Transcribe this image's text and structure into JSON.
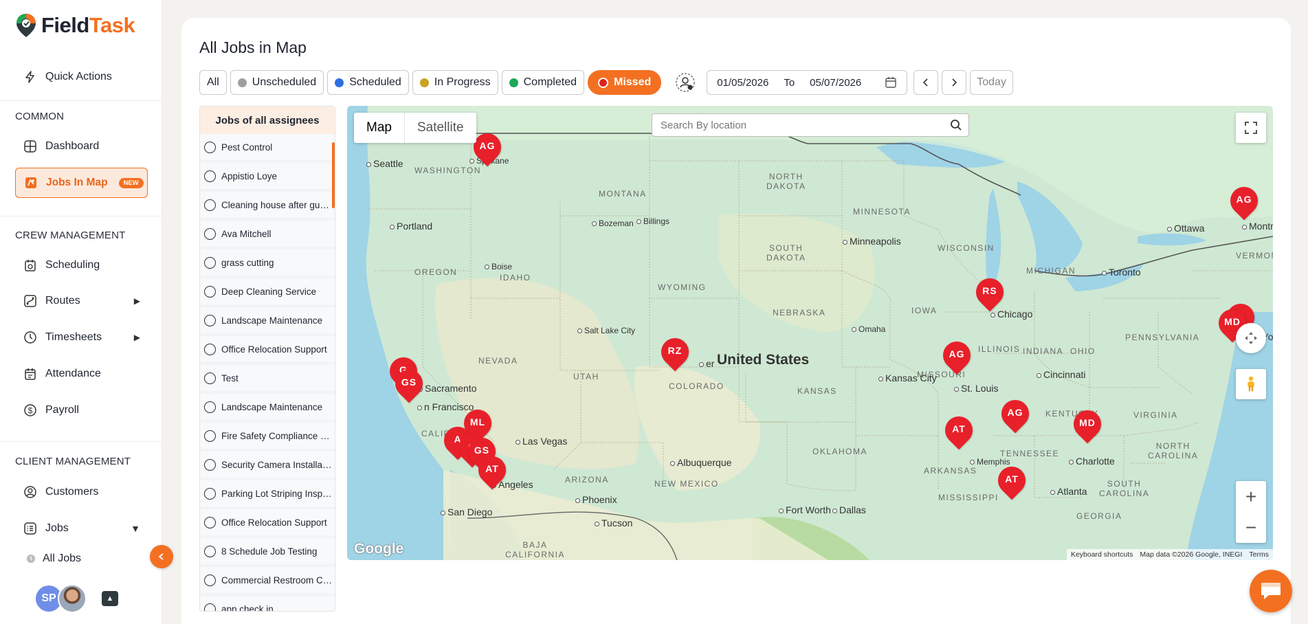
{
  "app": {
    "brand_main": "Field",
    "brand_accent": "Task"
  },
  "sidebar": {
    "quick_actions": "Quick Actions",
    "sections": {
      "common": "COMMON",
      "crew": "CREW MANAGEMENT",
      "client": "CLIENT MANAGEMENT"
    },
    "items": {
      "dashboard": "Dashboard",
      "jobs_in_map": "Jobs In Map",
      "new_badge": "NEW",
      "scheduling": "Scheduling",
      "routes": "Routes",
      "timesheets": "Timesheets",
      "attendance": "Attendance",
      "payroll": "Payroll",
      "customers": "Customers",
      "jobs": "Jobs",
      "all_jobs": "All Jobs"
    },
    "user_initials": "SP"
  },
  "page": {
    "title": "All Jobs in Map"
  },
  "filters": {
    "all": "All",
    "unscheduled": "Unscheduled",
    "scheduled": "Scheduled",
    "in_progress": "In Progress",
    "completed": "Completed",
    "missed": "Missed",
    "colors": {
      "unscheduled": "#9e9e9e",
      "scheduled": "#2f6fe0",
      "in_progress": "#c9a41e",
      "completed": "#1fa85a",
      "missed": "#e02020",
      "accent": "#f37021"
    }
  },
  "date_range": {
    "from": "01/05/2026",
    "to_label": "To",
    "to": "05/07/2026",
    "today": "Today"
  },
  "job_list": {
    "header": "Jobs of all assignees",
    "jobs": [
      "Pest Control",
      "Appistio Loye",
      "Cleaning house after guests",
      "Ava Mitchell",
      "grass cutting",
      "Deep Cleaning Service",
      "Landscape Maintenance",
      "Office Relocation Support",
      "Test",
      "Landscape Maintenance",
      "Fire Safety Compliance Check",
      "Security Camera Installation",
      "Parking Lot Striping Inspection",
      "Office Relocation Support",
      "8 Schedule Job Testing",
      "Commercial Restroom Cleaning",
      "app check in"
    ]
  },
  "map": {
    "type_map": "Map",
    "type_satellite": "Satellite",
    "search_placeholder": "Search By location",
    "google": "Google",
    "attribution": {
      "shortcuts": "Keyboard shortcuts",
      "data": "Map data ©2026 Google, INEGI",
      "terms": "Terms"
    },
    "country": "United States",
    "states": {
      "washington": "WASHINGTON",
      "oregon": "OREGON",
      "idaho": "IDAHO",
      "montana": "MONTANA",
      "wyoming": "WYOMING",
      "nevada": "NEVADA",
      "utah": "UTAH",
      "colorado": "COLORADO",
      "california": "CALIFORNIA",
      "arizona": "ARIZONA",
      "new_mexico": "NEW MEXICO",
      "north_dakota": "NORTH\nDAKOTA",
      "south_dakota": "SOUTH\nDAKOTA",
      "nebraska": "NEBRASKA",
      "kansas": "KANSAS",
      "oklahoma": "OKLAHOMA",
      "minnesota": "MINNESOTA",
      "iowa": "IOWA",
      "missouri": "MISSOURI",
      "arkansas": "ARKANSAS",
      "mississippi": "MISSISSIPPI",
      "wisconsin": "WISCONSIN",
      "michigan": "MICHIGAN",
      "illinois": "ILLINOIS",
      "indiana": "INDIANA",
      "ohio": "OHIO",
      "kentucky": "KENTUCKY",
      "tennessee": "TENNESSEE",
      "georgia": "GEORGIA",
      "pennsylvania": "PENNSYLVANIA",
      "virginia": "VIRGINIA",
      "north_carolina": "NORTH\nCAROLINA",
      "south_carolina": "SOUTH\nCAROLINA",
      "vermont": "VERMONT",
      "baja": "BAJA\nCALIFORNIA"
    },
    "cities": {
      "seattle": "Seattle",
      "spokane": "Spokane",
      "portland": "Portland",
      "boise": "Boise",
      "bozeman": "Bozeman",
      "billings": "Billings",
      "salt_lake": "Salt Lake City",
      "sacramento": "Sacramento",
      "san_francisco": "n Francisco",
      "las_vegas": "Las Vegas",
      "los_angeles": "Angeles",
      "san_diego": "San Diego",
      "phoenix": "Phoenix",
      "tucson": "Tucson",
      "albuquerque": "Albuquerque",
      "denver": "er",
      "omaha": "Omaha",
      "minneapolis": "Minneapolis",
      "kansas_city": "Kansas City",
      "st_louis": "St. Louis",
      "chicago": "Chicago",
      "memphis": "Memphis",
      "fort_worth": "Fort Worth",
      "dallas": "Dallas",
      "atlanta": "Atlanta",
      "charlotte": "Charlotte",
      "cincinnati": "Cincinnati",
      "toronto": "Toronto",
      "ottawa": "Ottawa",
      "montreal": "Montr",
      "new_york": "New Yo"
    },
    "pins": [
      "AG",
      "AG",
      "RS",
      "MD",
      "S",
      "RZ",
      "AG",
      "G",
      "GS",
      "ML",
      "A",
      "C",
      "GS",
      "AT",
      "AT",
      "AG",
      "MD",
      "AT"
    ]
  }
}
